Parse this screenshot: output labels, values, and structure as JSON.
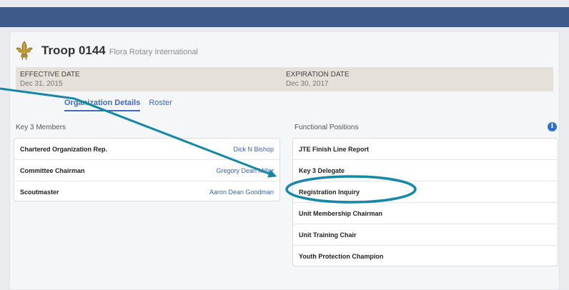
{
  "header": {
    "troop_name": "Troop 0144",
    "sponsor": "Flora Rotary International"
  },
  "dates": {
    "effective_label": "EFFECTIVE DATE",
    "effective_value": "Dec 31, 2015",
    "expiration_label": "EXPIRATION DATE",
    "expiration_value": "Dec 30, 2017"
  },
  "tabs": [
    {
      "label": "Organization Details",
      "active": true
    },
    {
      "label": "Roster",
      "active": false
    }
  ],
  "key3": {
    "title": "Key 3 Members",
    "rows": [
      {
        "position": "Chartered Organization Rep.",
        "person": "Dick N Bishop"
      },
      {
        "position": "Committee Chairman",
        "person": "Gregory Dean Miller"
      },
      {
        "position": "Scoutmaster",
        "person": "Aaron Dean Goodman"
      }
    ]
  },
  "functional": {
    "title": "Functional Positions",
    "rows": [
      "JTE Finish Line Report",
      "Key 3 Delegate",
      "Registration Inquiry",
      "Unit Membership Chairman",
      "Unit Training Chair",
      "Youth Protection Champion"
    ]
  },
  "colors": {
    "navbar": "#3d5a8a",
    "annotation": "#1687a7",
    "link": "#3a63b0"
  }
}
